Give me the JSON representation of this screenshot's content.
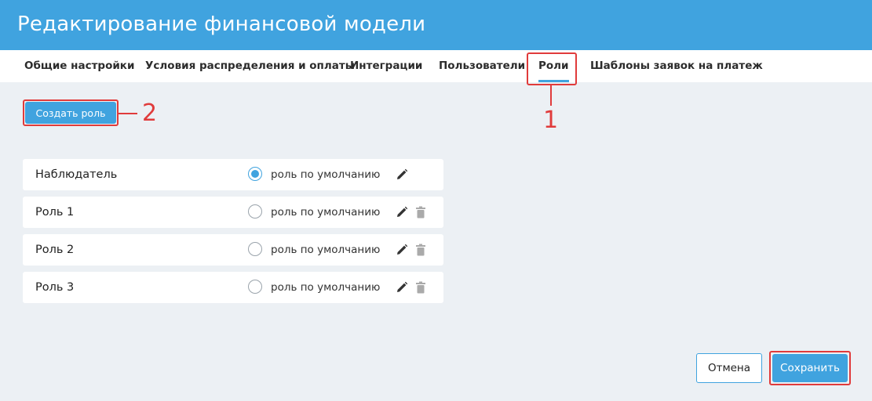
{
  "header": {
    "title": "Редактирование финансовой модели"
  },
  "tabs": [
    {
      "label": "Общие настройки",
      "active": false
    },
    {
      "label": "Условия распределения и оплаты",
      "active": false
    },
    {
      "label": "Интеграции",
      "active": false
    },
    {
      "label": "Пользователи",
      "active": false
    },
    {
      "label": "Роли",
      "active": true
    },
    {
      "label": "Шаблоны заявок на платеж",
      "active": false
    }
  ],
  "toolbar": {
    "create_role_label": "Создать роль"
  },
  "roles": [
    {
      "name": "Наблюдатель",
      "default_label": "роль по умолчанию",
      "is_default": true,
      "icons": [
        "pencil-icon"
      ]
    },
    {
      "name": "Роль 1",
      "default_label": "роль по умолчанию",
      "is_default": false,
      "icons": [
        "pencil-icon",
        "trash-icon"
      ]
    },
    {
      "name": "Роль 2",
      "default_label": "роль по умолчанию",
      "is_default": false,
      "icons": [
        "pencil-icon",
        "trash-icon"
      ]
    },
    {
      "name": "Роль 3",
      "default_label": "роль по умолчанию",
      "is_default": false,
      "icons": [
        "pencil-icon",
        "trash-icon"
      ]
    }
  ],
  "annotations": {
    "tab_marker": "1",
    "create_marker": "2"
  },
  "footer": {
    "cancel_label": "Отмена",
    "save_label": "Сохранить"
  },
  "colors": {
    "accent": "#40a3df",
    "annotation": "#e03b3b",
    "background": "#ecf0f4"
  }
}
